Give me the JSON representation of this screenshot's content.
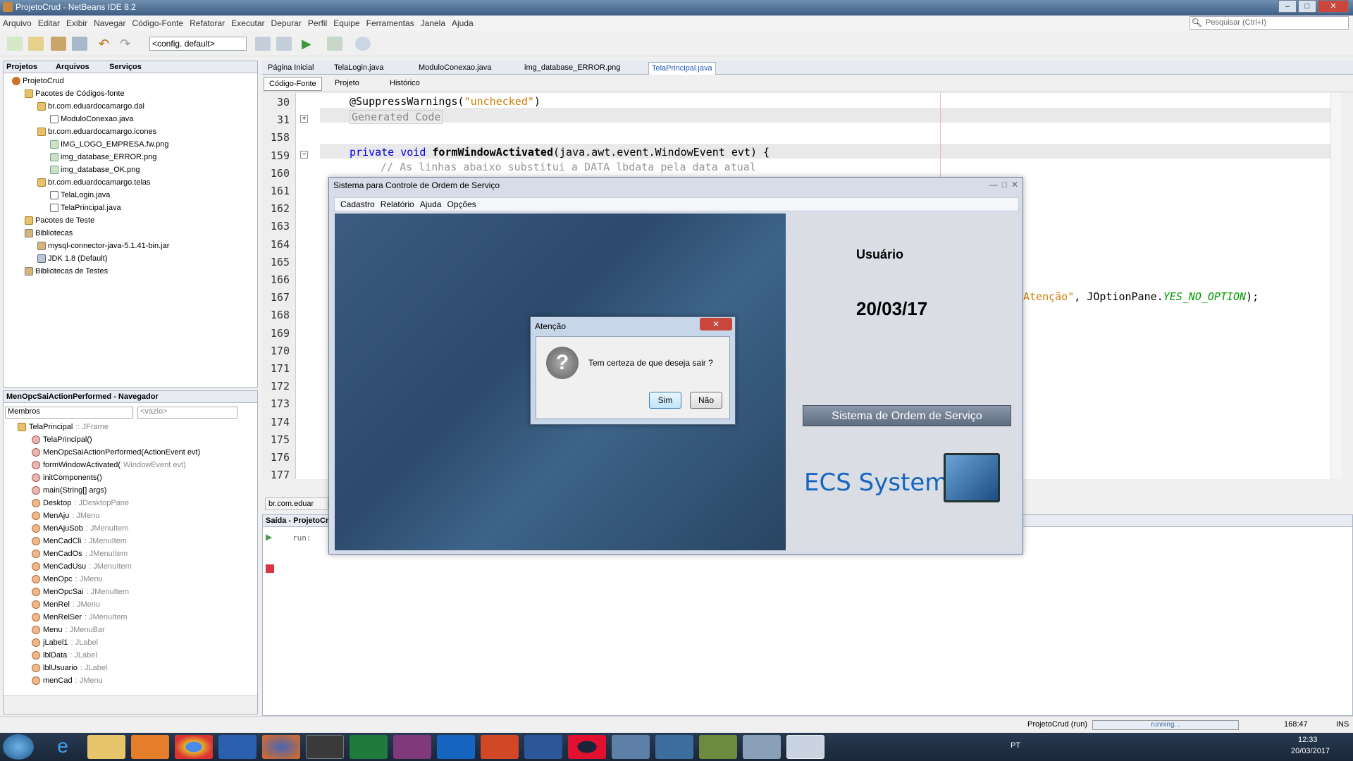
{
  "window": {
    "title": "ProjetoCrud - NetBeans IDE 8.2"
  },
  "menu": [
    "Arquivo",
    "Editar",
    "Exibir",
    "Navegar",
    "Código-Fonte",
    "Refatorar",
    "Executar",
    "Depurar",
    "Perfil",
    "Equipe",
    "Ferramentas",
    "Janela",
    "Ajuda"
  ],
  "search": {
    "placeholder": "Pesquisar (Ctrl+I)"
  },
  "toolbar": {
    "config": "<config. default>"
  },
  "projects": {
    "tabs": [
      "Projetos",
      "Arquivos",
      "Serviços"
    ],
    "tree": [
      "ProjetoCrud",
      "Pacotes de Códigos-fonte",
      "br.com.eduardocamargo.dal",
      "ModuloConexao.java",
      "br.com.eduardocamargo.icones",
      "IMG_LOGO_EMPRESA.fw.png",
      "img_database_ERROR.png",
      "img_database_OK.png",
      "br.com.eduardocamargo.telas",
      "TelaLogin.java",
      "TelaPrincipal.java",
      "Pacotes de Teste",
      "Bibliotecas",
      "mysql-connector-java-5.1.41-bin.jar",
      "JDK 1.8 (Default)",
      "Bibliotecas de Testes"
    ]
  },
  "navigator": {
    "title": "MenOpcSaiActionPerformed - Navegador",
    "filter": "Membros",
    "empty": "<vazio>",
    "root": "TelaPrincipal",
    "root_type": " :: JFrame",
    "items": [
      [
        "TelaPrincipal()",
        ""
      ],
      [
        "MenOpcSaiActionPerformed(ActionEvent evt)",
        ""
      ],
      [
        "formWindowActivated(",
        "WindowEvent evt)"
      ],
      [
        "initComponents()",
        ""
      ],
      [
        "main(String[] args)",
        ""
      ],
      [
        "Desktop",
        " : JDesktopPane"
      ],
      [
        "MenAju",
        " : JMenu"
      ],
      [
        "MenAjuSob",
        " : JMenuItem"
      ],
      [
        "MenCadCli",
        " : JMenuItem"
      ],
      [
        "MenCadOs",
        " : JMenuItem"
      ],
      [
        "MenCadUsu",
        " : JMenuItem"
      ],
      [
        "MenOpc",
        " : JMenu"
      ],
      [
        "MenOpcSai",
        " : JMenuItem"
      ],
      [
        "MenRel",
        " : JMenu"
      ],
      [
        "MenRelSer",
        " : JMenuItem"
      ],
      [
        "Menu",
        " : JMenuBar"
      ],
      [
        "jLabel1",
        " : JLabel"
      ],
      [
        "lblData",
        " : JLabel"
      ],
      [
        "lblUsuario",
        " : JLabel"
      ],
      [
        "menCad",
        " : JMenu"
      ]
    ]
  },
  "editor": {
    "tabs": [
      "Página Inicial",
      "TelaLogin.java",
      "ModuloConexao.java",
      "img_database_ERROR.png",
      "TelaPrincipal.java"
    ],
    "views": [
      "Código-Fonte",
      "Projeto",
      "Histórico"
    ],
    "line_numbers": [
      "30",
      "31",
      "158",
      "159",
      "160",
      "161",
      "162",
      "163",
      "164",
      "165",
      "166",
      "167",
      "168",
      "169",
      "170",
      "171",
      "172",
      "173",
      "174",
      "175",
      "176",
      "177"
    ],
    "line30": "@SuppressWarnings(",
    "line30_str": "\"unchecked\"",
    "line30_end": ")",
    "line31": "Generated Code",
    "line159_kw": "private void ",
    "line159_name": "formWindowActivated",
    "line159_rest": "(java.awt.event.WindowEvent evt) {",
    "line160": "// As linhas abaixo substitui a DATA lbdata pela data atual",
    "line169_str": "Atenção\"",
    "line169_rest": ", JOptionPane.",
    "line169_const": "YES_NO_OPTION",
    "line169_end": ");",
    "breadcrumb": "br.com.eduar"
  },
  "output": {
    "title": "Saída - ProjetoCr",
    "text": "run:"
  },
  "app_window": {
    "title": "Sistema para Controle de Ordem de Serviço",
    "menu": [
      "Cadastro",
      "Relatório",
      "Ajuda",
      "Opções"
    ],
    "user_label": "Usuário",
    "date": "20/03/17",
    "banner": "Sistema de Ordem de Serviço",
    "logo_text": "ECS System"
  },
  "dialog": {
    "title": "Atenção",
    "message": "Tem certeza de que deseja sair ?",
    "yes": "Sim",
    "no": "Não"
  },
  "status": {
    "project": "ProjetoCrud (run)",
    "progress": "running...",
    "position": "168:47",
    "mode": "INS"
  },
  "taskbar": {
    "lang": "PT",
    "time": "12:33",
    "date": "20/03/2017"
  }
}
